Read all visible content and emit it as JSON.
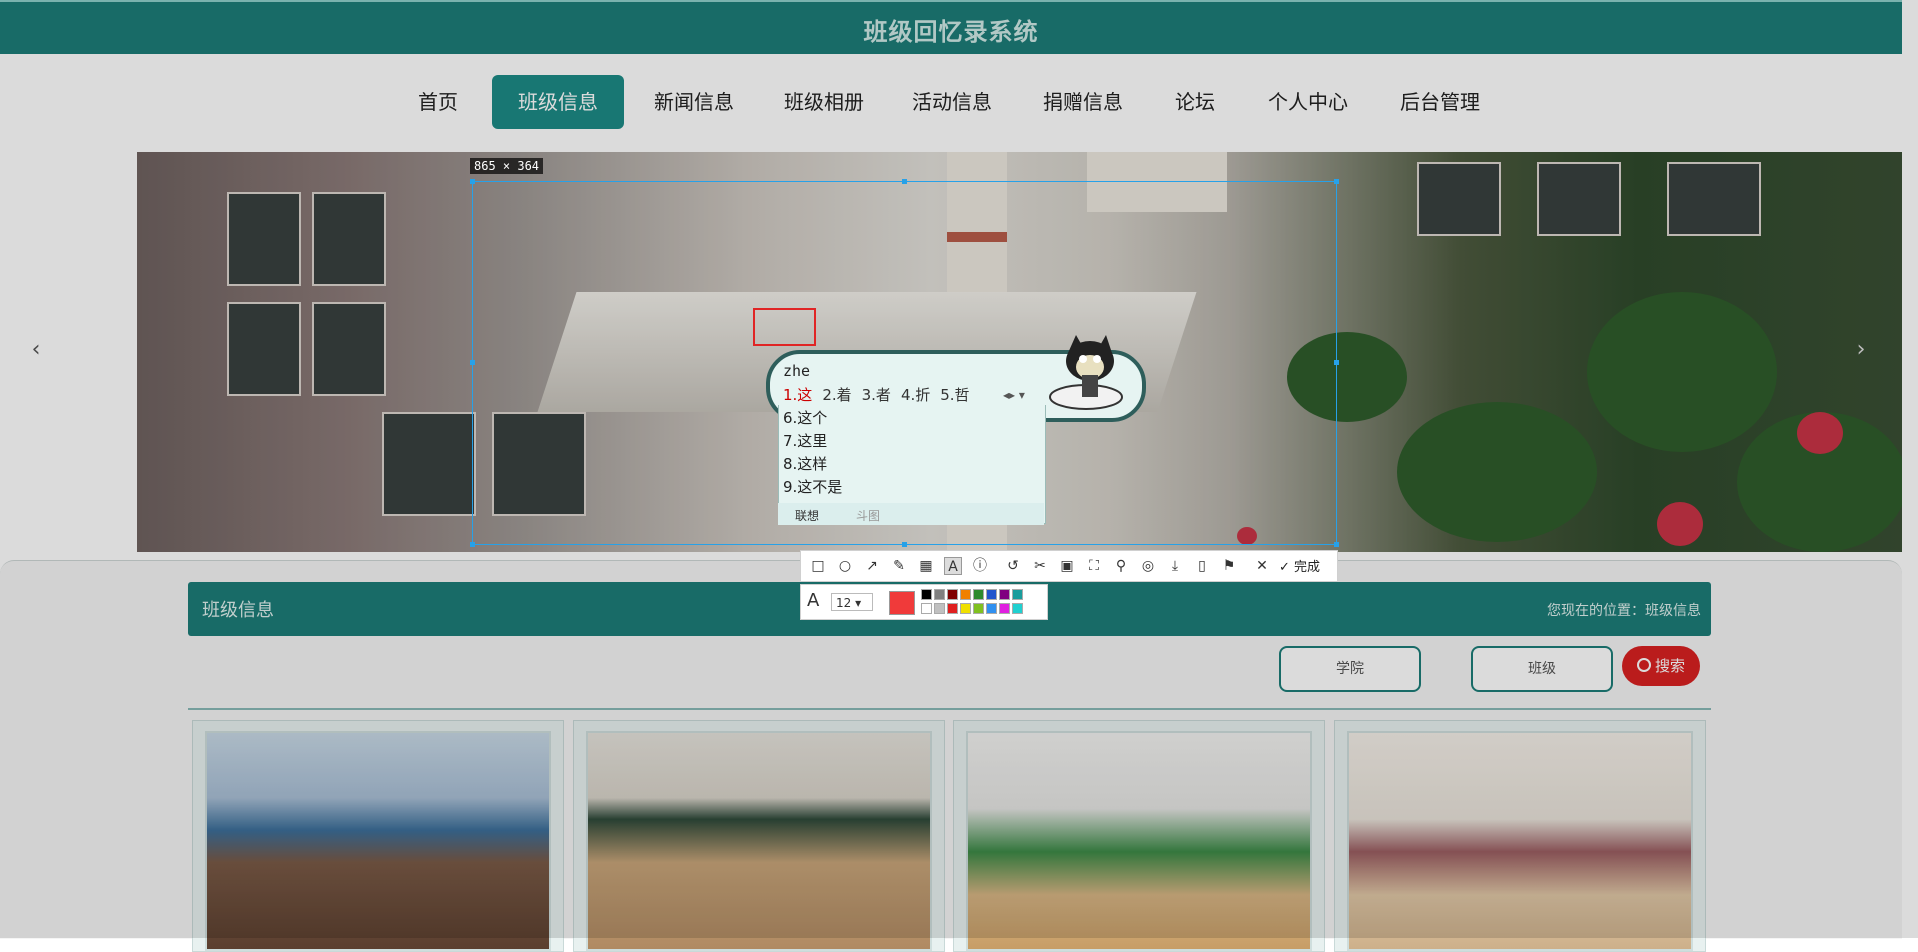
{
  "site": {
    "title": "班级回忆录系统"
  },
  "nav": {
    "items": [
      "首页",
      "班级信息",
      "新闻信息",
      "班级相册",
      "活动信息",
      "捐赠信息",
      "论坛",
      "个人中心",
      "后台管理"
    ],
    "active": "班级信息"
  },
  "hero": {
    "prev_icon": "chevron-left-icon",
    "next_icon": "chevron-right-icon"
  },
  "section": {
    "title": "班级信息",
    "breadcrumb": "您现在的位置：班级信息"
  },
  "filters": {
    "college_label": "学院",
    "class_label": "班级",
    "search_label": "搜索"
  },
  "screenshot_tool": {
    "size_label": "865 × 364",
    "toolbar_icons": [
      "rectangle-icon",
      "ellipse-icon",
      "arrow-icon",
      "pen-icon",
      "mosaic-icon",
      "text-icon",
      "number-icon",
      "undo-icon",
      "scissors-icon",
      "ocr-icon",
      "capture-icon",
      "pin-icon",
      "record-icon",
      "download-icon",
      "phone-icon",
      "bookmark-icon",
      "close-icon"
    ],
    "active_tool": "text-icon",
    "done_label": "完成",
    "font_size": "12",
    "current_color": "#f03a3a",
    "colors_top": [
      "#000000",
      "#808080",
      "#800000",
      "#f08000",
      "#2e8b2e",
      "#2255cc",
      "#800080",
      "#1a9c9c"
    ],
    "colors_bottom": [
      "#ffffff",
      "#c0c0c0",
      "#e02020",
      "#f0e000",
      "#80c020",
      "#3090f0",
      "#e020e0",
      "#20d0d0"
    ]
  },
  "ime": {
    "pinyin": "zhe",
    "candidates": [
      "1.这",
      "2.着",
      "3.者",
      "4.折",
      "5.哲"
    ],
    "list": [
      "6.这个",
      "7.这里",
      "8.这样",
      "9.这不是"
    ],
    "tabs": [
      "联想",
      "斗图"
    ]
  }
}
